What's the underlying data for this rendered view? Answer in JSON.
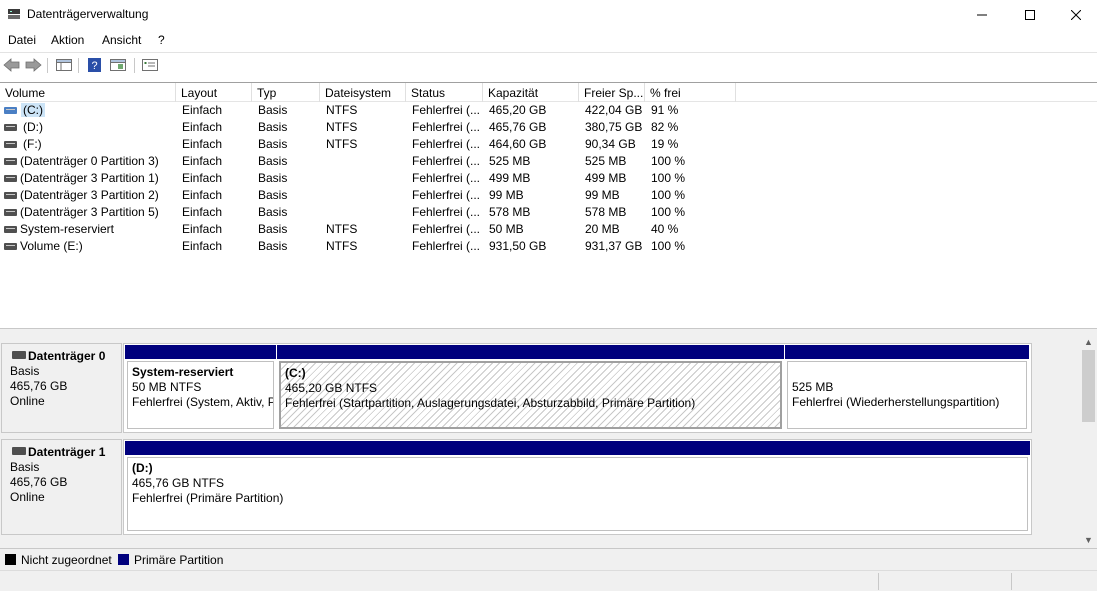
{
  "window": {
    "title": "Datenträgerverwaltung"
  },
  "menu": [
    "Datei",
    "Aktion",
    "Ansicht",
    "?"
  ],
  "volume_list": {
    "columns": [
      "Volume",
      "Layout",
      "Typ",
      "Dateisystem",
      "Status",
      "Kapazität",
      "Freier Sp...",
      "% frei"
    ],
    "rows": [
      {
        "volume": "(C:)",
        "layout": "Einfach",
        "typ": "Basis",
        "fs": "NTFS",
        "status": "Fehlerfrei (...",
        "cap": "465,20 GB",
        "free": "422,04 GB",
        "pct": "91 %",
        "selected": true
      },
      {
        "volume": "(D:)",
        "layout": "Einfach",
        "typ": "Basis",
        "fs": "NTFS",
        "status": "Fehlerfrei (...",
        "cap": "465,76 GB",
        "free": "380,75 GB",
        "pct": "82 %"
      },
      {
        "volume": "(F:)",
        "layout": "Einfach",
        "typ": "Basis",
        "fs": "NTFS",
        "status": "Fehlerfrei (...",
        "cap": "464,60 GB",
        "free": "90,34 GB",
        "pct": "19 %"
      },
      {
        "volume": "(Datenträger 0 Partition 3)",
        "layout": "Einfach",
        "typ": "Basis",
        "fs": "",
        "status": "Fehlerfrei (...",
        "cap": "525 MB",
        "free": "525 MB",
        "pct": "100 %"
      },
      {
        "volume": "(Datenträger 3 Partition 1)",
        "layout": "Einfach",
        "typ": "Basis",
        "fs": "",
        "status": "Fehlerfrei (...",
        "cap": "499 MB",
        "free": "499 MB",
        "pct": "100 %"
      },
      {
        "volume": "(Datenträger 3 Partition 2)",
        "layout": "Einfach",
        "typ": "Basis",
        "fs": "",
        "status": "Fehlerfrei (...",
        "cap": "99 MB",
        "free": "99 MB",
        "pct": "100 %"
      },
      {
        "volume": "(Datenträger 3 Partition 5)",
        "layout": "Einfach",
        "typ": "Basis",
        "fs": "",
        "status": "Fehlerfrei (...",
        "cap": "578 MB",
        "free": "578 MB",
        "pct": "100 %"
      },
      {
        "volume": "System-reserviert",
        "layout": "Einfach",
        "typ": "Basis",
        "fs": "NTFS",
        "status": "Fehlerfrei (...",
        "cap": "50 MB",
        "free": "20 MB",
        "pct": "40 %"
      },
      {
        "volume": "Volume (E:)",
        "layout": "Einfach",
        "typ": "Basis",
        "fs": "NTFS",
        "status": "Fehlerfrei (...",
        "cap": "931,50 GB",
        "free": "931,37 GB",
        "pct": "100 %"
      }
    ]
  },
  "disks": [
    {
      "name": "Datenträger 0",
      "type": "Basis",
      "size": "465,76 GB",
      "state": "Online",
      "partitions": [
        {
          "name": "System-reserviert",
          "size": "50 MB NTFS",
          "status": "Fehlerfrei (System, Aktiv, Primäre Partition)"
        },
        {
          "name": "(C:)",
          "size": "465,20 GB NTFS",
          "status": "Fehlerfrei (Startpartition, Auslagerungsdatei, Absturzabbild, Primäre Partition)"
        },
        {
          "name": "",
          "size": "525 MB",
          "status": "Fehlerfrei (Wiederherstellungspartition)"
        }
      ]
    },
    {
      "name": "Datenträger 1",
      "type": "Basis",
      "size": "465,76 GB",
      "state": "Online",
      "partitions": [
        {
          "name": "(D:)",
          "size": "465,76 GB NTFS",
          "status": "Fehlerfrei (Primäre Partition)"
        }
      ]
    }
  ],
  "legend": [
    "Nicht zugeordnet",
    "Primäre Partition"
  ],
  "colors": {
    "primary_partition": "#00007d",
    "unallocated": "#000000",
    "selection": "#cce4f7"
  },
  "icons": {
    "app": "disk-management-icon",
    "toolbar": [
      "back-arrow-icon",
      "forward-arrow-icon",
      "console-tree-icon",
      "help-icon",
      "properties-icon",
      "list-view-icon"
    ]
  }
}
